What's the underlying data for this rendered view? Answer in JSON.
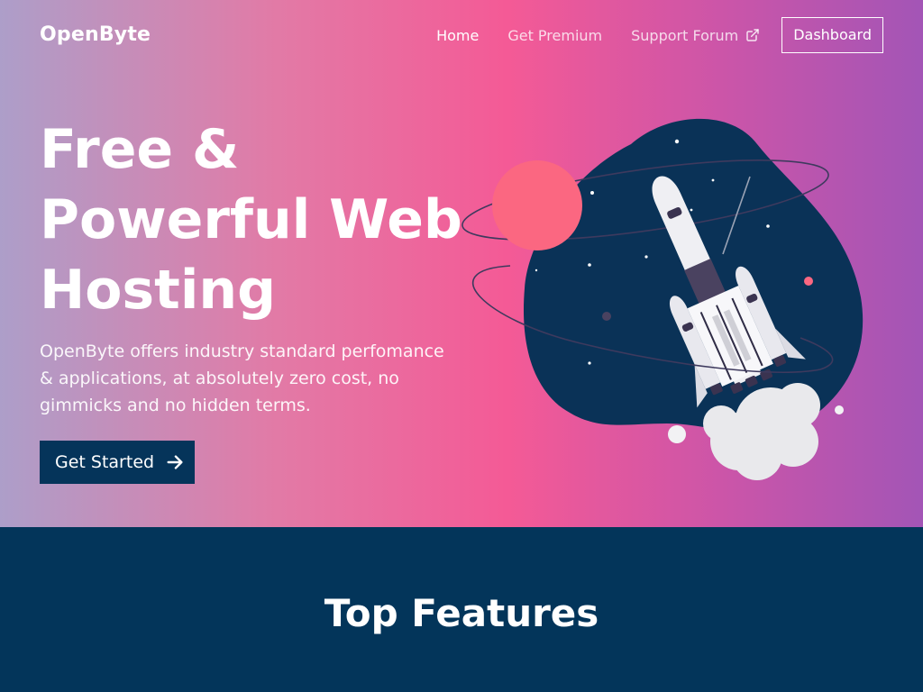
{
  "brand": {
    "logo": "OpenByte"
  },
  "nav": {
    "home": "Home",
    "premium": "Get Premium",
    "forum": "Support Forum",
    "dashboard": "Dashboard"
  },
  "hero": {
    "headline": "Free & Powerful Web Hosting",
    "subtext": "OpenByte offers industry standard perfomance & applications, at absolutely zero cost, no gimmicks and no hidden terms.",
    "cta_label": "Get Started",
    "cta_icon": "arrow-right-icon",
    "illustration": "rocket-illustration"
  },
  "features": {
    "title": "Top Features"
  },
  "colors": {
    "navy": "#03355a",
    "pink": "#f45a96",
    "purple": "#a355b6",
    "planet": "#fb6781"
  }
}
